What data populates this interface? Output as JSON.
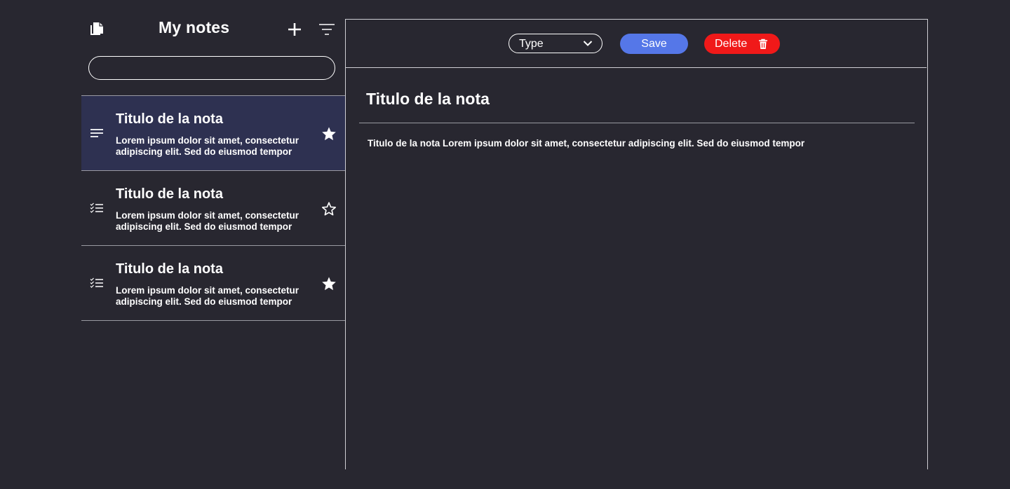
{
  "sidebar": {
    "title": "My notes",
    "search": {
      "value": "",
      "placeholder": ""
    },
    "icons": {
      "logo": "notes-stack-icon",
      "add": "plus-icon",
      "filter": "filter-lines-icon"
    },
    "notes": [
      {
        "title": "Titulo de la nota",
        "preview_line1": "Lorem ipsum dolor sit amet, consectetur",
        "preview_line2": "adipiscing elit. Sed do eiusmod tempor",
        "type_icon": "text-lines-icon",
        "starred": true,
        "selected": true
      },
      {
        "title": "Titulo de la nota",
        "preview_line1": "Lorem ipsum dolor sit amet, consectetur",
        "preview_line2": "adipiscing elit. Sed do eiusmod tempor",
        "type_icon": "checklist-icon",
        "starred": false,
        "selected": false
      },
      {
        "title": "Titulo de la nota",
        "preview_line1": "Lorem ipsum dolor sit amet, consectetur",
        "preview_line2": "adipiscing elit. Sed do eiusmod tempor",
        "type_icon": "checklist-icon",
        "starred": true,
        "selected": false
      }
    ]
  },
  "editor": {
    "toolbar": {
      "type_select_value": "Type",
      "save_label": "Save",
      "delete_label": "Delete"
    },
    "note_title": "Titulo de la nota",
    "note_body": "Titulo de la nota Lorem ipsum dolor sit amet, consectetur adipiscing elit. Sed do eiusmod tempor"
  },
  "colors": {
    "background": "#282730",
    "selected_item": "#2e3151",
    "save": "#5577e8",
    "delete": "#f01919",
    "divider": "#9a9aa2"
  }
}
